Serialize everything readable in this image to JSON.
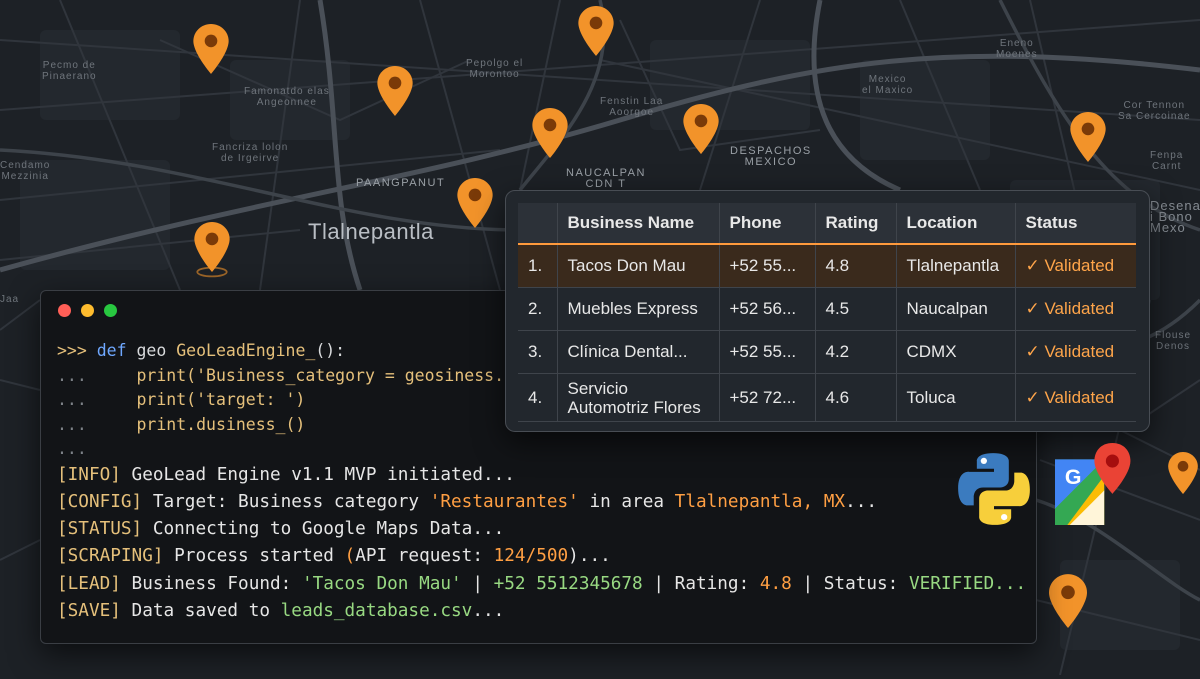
{
  "map": {
    "labels": {
      "tlalnepantla": "Tlalnepantla",
      "naucalpan": "NAUCALPAN\nCDN T",
      "paangpanut": "PAANGPANUT",
      "mexico": "DESPACHOS\nMEXICO",
      "misc1": "Pecmo de\nPinaerano",
      "misc2": "Pepolgo el\nMorontoo",
      "misc3": "Fancriza lolon\nde Irgeirve",
      "misc4": "Famonatdo elas\nAngeonnee",
      "misc5": "Mexico\nel Maxico",
      "misc6": "Cor Tennon\nSa Cercoinae",
      "misc7": "Fenstin Laa\nAoorgoe",
      "misc8": "Jaa",
      "misc9": "Cendamo\nMezzinia",
      "misc10": "Fenpa\nCarnt",
      "misc11": "Eneno\nMoenes",
      "misc12": "Desena\ni Bono\nMexo",
      "misc13": "Flouse\nDenos"
    },
    "pin_color": "#f2932a"
  },
  "terminal": {
    "code": [
      {
        "prompt": ">>>",
        "def": "def",
        "text": " geo ",
        "fn": "GeoLeadEngine_",
        "rest": "():"
      },
      {
        "prompt": "...",
        "text": "    print('Business_category = geosiness."
      },
      {
        "prompt": "...",
        "text": "    print('target: ')"
      },
      {
        "prompt": "...",
        "text": "    print.dusiness_()"
      },
      {
        "prompt": "...",
        "text": ""
      }
    ],
    "logs": {
      "info": {
        "tag": "[INFO]",
        "text": " GeoLead Engine v1.1 MVP initiated..."
      },
      "config": {
        "tag": "[CONFIG]",
        "pre": " Target: Business category ",
        "category": "'Restaurantes'",
        "mid": " in area ",
        "area": "Tlalnepantla, MX",
        "post": "..."
      },
      "status": {
        "tag": "[STATUS]",
        "text": " Connecting to Google Maps Data..."
      },
      "scraping": {
        "tag": "[SCRAPING]",
        "pre": " Process started ",
        "paren_open": "(",
        "api_label": "API request: ",
        "api_value": "124/500",
        "post": ")..."
      },
      "lead": {
        "tag": "[LEAD]",
        "pre": " Business Found: ",
        "name": "'Tacos Don Mau'",
        "sep1": " | ",
        "phone": "+52 5512345678",
        "sep2": " | ",
        "rating_label": "Rating: ",
        "rating": "4.8",
        "sep3": " | ",
        "status_label": "Status: ",
        "status": "VERIFIED..."
      },
      "save": {
        "tag": "[SAVE]",
        "pre": " Data saved to ",
        "file": "leads_database.csv",
        "post": "..."
      }
    }
  },
  "table": {
    "headers": [
      "",
      "Business Name",
      "Phone",
      "Rating",
      "Location",
      "Status"
    ],
    "rows": [
      {
        "num": "1.",
        "name": "Tacos Don Mau",
        "phone": "+52 55...",
        "rating": "4.8",
        "location": "Tlalnepantla",
        "status": "Validated"
      },
      {
        "num": "2.",
        "name": "Muebles Express",
        "phone": "+52 56...",
        "rating": "4.5",
        "location": "Naucalpan",
        "status": "Validated"
      },
      {
        "num": "3.",
        "name": "Clínica Dental...",
        "phone": "+52 55...",
        "rating": "4.2",
        "location": "CDMX",
        "status": "Validated"
      },
      {
        "num": "4.",
        "name_line1": "Servicio",
        "name_line2": "Automotriz Flores",
        "phone": "+52 72...",
        "rating": "4.6",
        "location": "Toluca",
        "status": "Validated"
      }
    ],
    "check_icon": "check-icon",
    "accent": "#ff9a3c"
  },
  "logos": {
    "python": "python-logo",
    "maps": "google-maps-logo",
    "maps_letter": "G"
  },
  "window_controls": {
    "close": "#ff5f57",
    "minimize": "#febc2e",
    "maximize": "#28c840"
  }
}
